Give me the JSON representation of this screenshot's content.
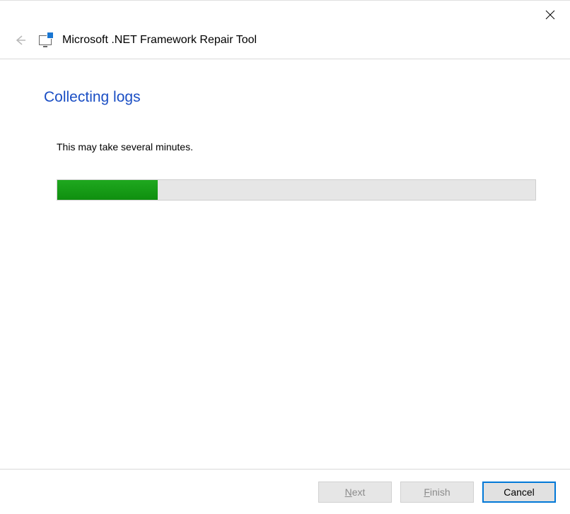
{
  "window": {
    "title": "Microsoft .NET Framework Repair Tool"
  },
  "page": {
    "heading": "Collecting logs",
    "status_text": "This may take several minutes."
  },
  "progress": {
    "percent": 21
  },
  "buttons": {
    "next_prefix": "N",
    "next_rest": "ext",
    "finish_prefix": "F",
    "finish_rest": "inish",
    "cancel": "Cancel"
  }
}
